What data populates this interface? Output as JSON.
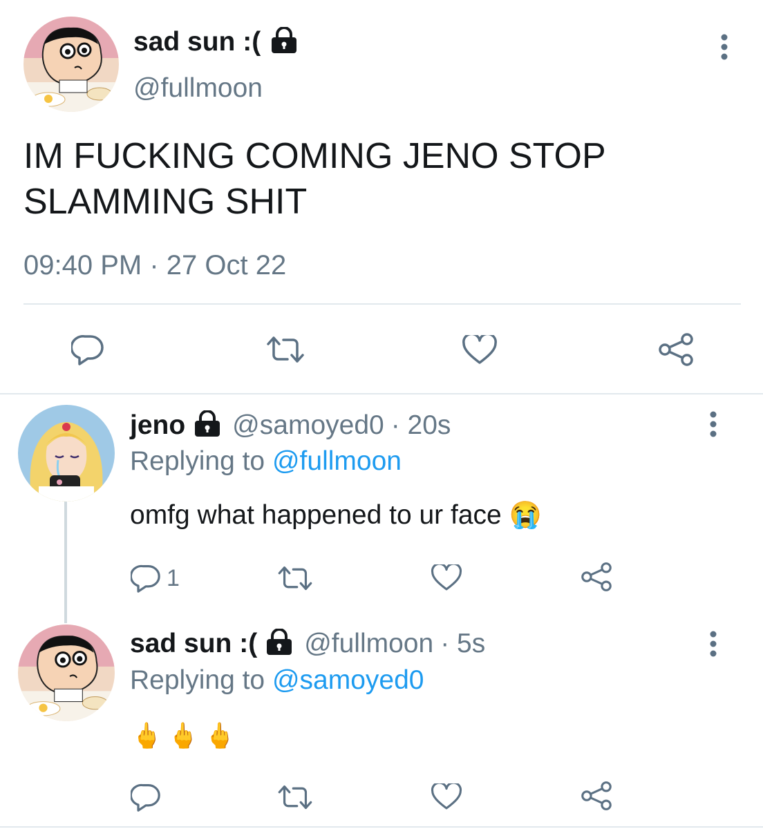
{
  "main_tweet": {
    "display_name": "sad sun :(",
    "handle": "@fullmoon",
    "text_line1": "IM FUCKING COMING JENO STOP",
    "text_line2": "SLAMMING SHIT",
    "timestamp": "09:40 PM · 27 Oct 22"
  },
  "reply1": {
    "display_name": "jeno",
    "handle": "@samoyed0",
    "time": "· 20s",
    "replying_label": "Replying to",
    "replying_handle": "@fullmoon",
    "text": "omfg what happened to ur face",
    "emoji": "😭",
    "reply_count": "1"
  },
  "reply2": {
    "display_name": "sad sun :(",
    "handle": "@fullmoon",
    "time": "· 5s",
    "replying_label": "Replying to",
    "replying_handle": "@samoyed0",
    "text": "🖕🖕🖕"
  },
  "colors": {
    "text": "#14171a",
    "secondary": "#657786",
    "link": "#1d9bf0",
    "divider": "#e1e8ed",
    "icon": "#5b7083"
  },
  "icons": [
    "lock-icon",
    "more-icon",
    "reply-icon",
    "retweet-icon",
    "like-icon",
    "share-icon"
  ]
}
